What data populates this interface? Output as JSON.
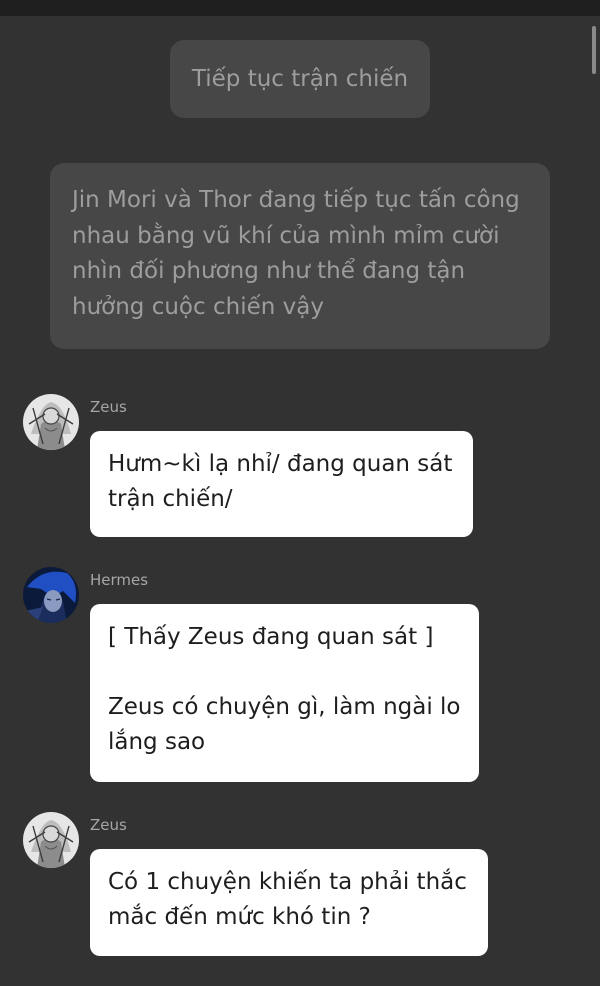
{
  "action_pill": {
    "text": "Tiếp tục trận chiến"
  },
  "narration": {
    "lines": [
      "Jin Mori và Thor đang tiếp tục tấn công",
      "nhau bằng vũ khí của mình mỉm cười",
      "nhìn đối phương như thể đang tận",
      "hưởng cuộc chiến vậy"
    ]
  },
  "messages": [
    {
      "sender": "Zeus",
      "lines": [
        "Hưm~kì lạ nhỉ/ đang quan sát",
        "trận chiến/"
      ]
    },
    {
      "sender": "Hermes",
      "lines": [
        "[ Thấy Zeus đang quan sát ]",
        "",
        "Zeus có chuyện gì, làm ngài lo",
        "lắng sao"
      ]
    },
    {
      "sender": "Zeus",
      "lines": [
        "Có 1 chuyện khiến ta phải thắc",
        "mắc đến mức khó tin ?"
      ]
    }
  ]
}
